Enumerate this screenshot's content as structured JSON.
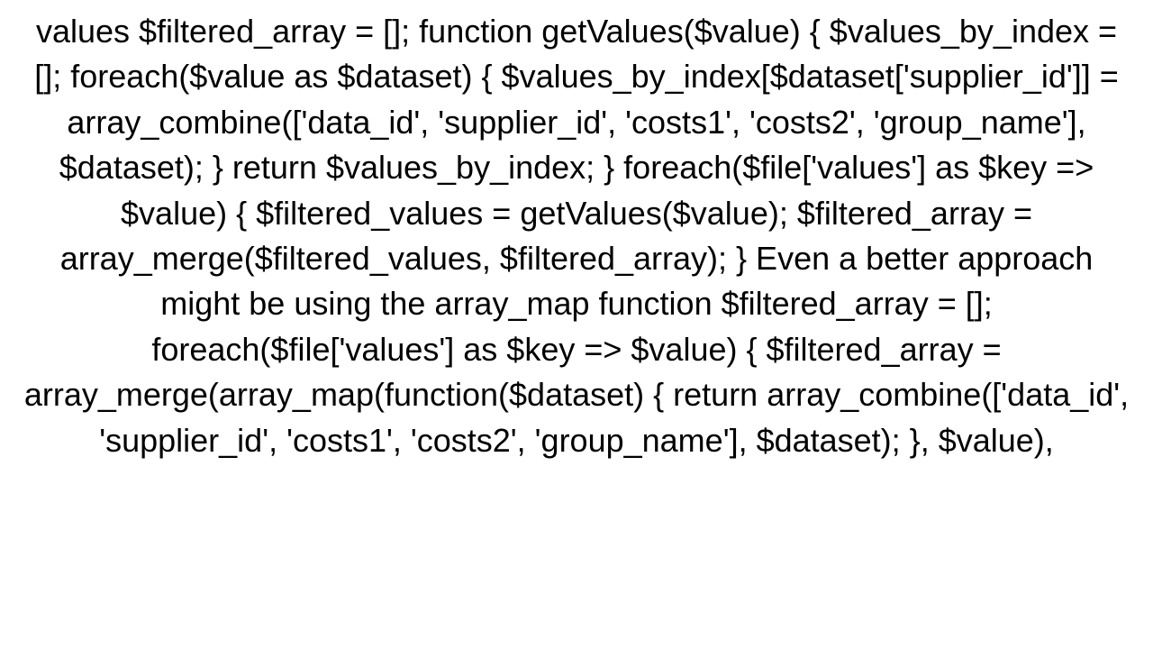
{
  "document": {
    "text": "values $filtered_array = [];  function getValues($value) {     $values_by_index = [];     foreach($value as $dataset) {         $values_by_index[$dataset['supplier_id']] = array_combine(['data_id', 'supplier_id', 'costs1', 'costs2', 'group_name'], $dataset);     }     return $values_by_index; }  foreach($file['values'] as $key => $value) {     $filtered_values = getValues($value);     $filtered_array = array_merge($filtered_values, $filtered_array); }  Even a better approach might be using the array_map function $filtered_array = []; foreach($file['values'] as $key => $value) {     $filtered_array = array_merge(array_map(function($dataset) {         return array_combine(['data_id', 'supplier_id', 'costs1', 'costs2', 'group_name'], $dataset);     }, $value),"
  }
}
